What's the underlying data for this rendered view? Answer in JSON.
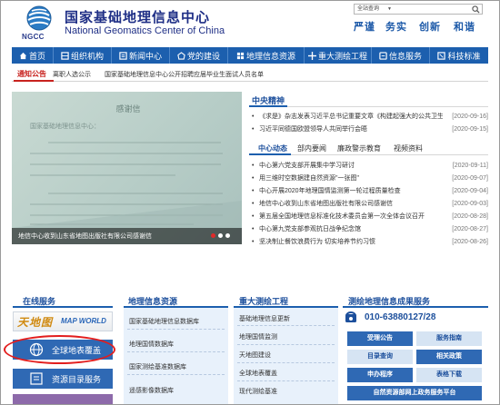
{
  "header": {
    "logo_abbr": "NGCC",
    "title_cn": "国家基础地理信息中心",
    "title_en": "National Geomatics Center of China",
    "search_scope": "全站查询",
    "search_placeholder": "",
    "motto": [
      "严谨",
      "务实",
      "创新",
      "和谐"
    ]
  },
  "nav": [
    {
      "label": "首页",
      "icon": "home-icon"
    },
    {
      "label": "组织机构",
      "icon": "org-icon"
    },
    {
      "label": "新闻中心",
      "icon": "news-icon"
    },
    {
      "label": "党的建设",
      "icon": "party-icon"
    },
    {
      "label": "地理信息资源",
      "icon": "resource-icon"
    },
    {
      "label": "重大测绘工程",
      "icon": "project-icon"
    },
    {
      "label": "信息服务",
      "icon": "service-icon"
    },
    {
      "label": "科技标准",
      "icon": "standard-icon"
    }
  ],
  "notice": {
    "label": "通知公告",
    "items": [
      "离职人选公示",
      "国家基础地理信息中心公开招聘应届毕业生面试人员名单"
    ]
  },
  "slideshow": {
    "caption": "地信中心收到山东省地图出版社有限公司感谢信",
    "dots": 3,
    "active_dot": 1
  },
  "central": {
    "title": "中央精神",
    "items": [
      {
        "text": "《求是》杂志发表习近平总书记重要文章《构建起强大的公共卫生体系》",
        "date": "[2020-09-16]"
      },
      {
        "text": "习近平同德国欧盟领导人共同举行会晤",
        "date": "[2020-09-15]"
      }
    ]
  },
  "tabs": {
    "items": [
      "中心动态",
      "部内要闻",
      "廉政警示教育",
      "视频资料"
    ],
    "active": 0
  },
  "center_news": [
    {
      "text": "中心第六党支部开展集中学习研讨",
      "date": "[2020-09-11]"
    },
    {
      "text": "用三维时空数据建自然资源\"一张图\"",
      "date": "[2020-09-07]"
    },
    {
      "text": "中心开展2020年地理国情监测第一轮过程质量检查",
      "date": "[2020-09-04]"
    },
    {
      "text": "地信中心收到山东省地图出版社有限公司感谢信",
      "date": "[2020-09-03]"
    },
    {
      "text": "第五届全国地理信息标准化技术委员会第一次全体会议召开",
      "date": "[2020-08-28]"
    },
    {
      "text": "中心第九党支部参观抗日战争纪念馆",
      "date": "[2020-08-27]"
    },
    {
      "text": "坚决制止餐饮浪费行为 切实培养节约习惯",
      "date": "[2020-08-26]"
    }
  ],
  "online": {
    "title": "在线服务",
    "banner_cn": "天地图",
    "banner_en": "MAP WORLD",
    "buttons": [
      "全球地表覆盖",
      "资源目录服务"
    ]
  },
  "resources": {
    "title": "地理信息资源",
    "items": [
      "国家基础地理信息数据库",
      "地理国情数据库",
      "国家测绘基准数据库",
      "遥感影像数据库"
    ]
  },
  "projects": {
    "title": "重大测绘工程",
    "items": [
      "基础地理信息更新",
      "地理国情监测",
      "天地图建设",
      "全球地表覆盖",
      "现代测绘基准"
    ]
  },
  "results": {
    "title": "测绘地理信息成果服务",
    "phone": "010-63880127/28",
    "buttons": [
      "受理公告",
      "服务指南",
      "目录查询",
      "相关政策",
      "申办程序",
      "表格下载",
      "自然资源部网上政务服务平台"
    ]
  },
  "colors": {
    "nav_blue": "#1c5fae",
    "title_navy": "#1f2f86",
    "notice_red": "#c8221e",
    "highlight_red": "#e21d1d"
  }
}
